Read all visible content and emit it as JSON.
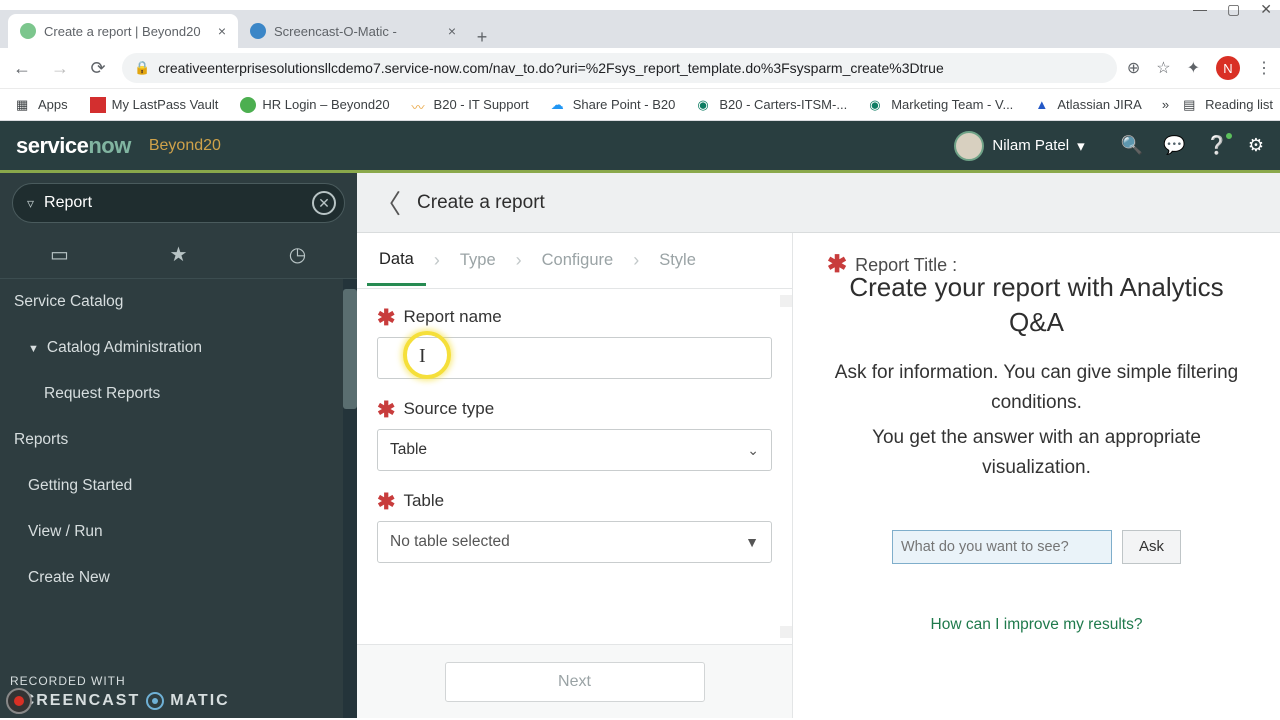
{
  "browser": {
    "tabs": [
      {
        "title": "Create a report | Beyond20",
        "favicon_color": "#7cc68d",
        "active": true
      },
      {
        "title": "Screencast-O-Matic -",
        "favicon_color": "#3b86c7",
        "active": false
      }
    ],
    "url": "creativeenterprisesolutionsllcdemo7.service-now.com/nav_to.do?uri=%2Fsys_report_template.do%3Fsysparm_create%3Dtrue",
    "avatar_letter": "N",
    "bookmarks": [
      {
        "label": "Apps",
        "icon": "grid"
      },
      {
        "label": "My LastPass Vault",
        "icon": "red"
      },
      {
        "label": "HR Login – Beyond20",
        "icon": "green"
      },
      {
        "label": "B20 - IT Support",
        "icon": "orange"
      },
      {
        "label": "Share Point - B20",
        "icon": "cloud"
      },
      {
        "label": "B20 - Carters-ITSM-...",
        "icon": "share"
      },
      {
        "label": "Marketing Team - V...",
        "icon": "share"
      },
      {
        "label": "Atlassian JIRA",
        "icon": "jira"
      }
    ],
    "reading_list": "Reading list"
  },
  "header": {
    "logo_a": "service",
    "logo_b": "now",
    "instance": "Beyond20",
    "user": "Nilam Patel"
  },
  "nav": {
    "filter_value": "Report",
    "items": [
      {
        "label": "Service Catalog",
        "cls": "section"
      },
      {
        "label": "Catalog Administration",
        "cls": "sub",
        "caret": true
      },
      {
        "label": "Request Reports",
        "cls": "subsub"
      },
      {
        "label": "Reports",
        "cls": "section"
      },
      {
        "label": "Getting Started",
        "cls": "sub"
      },
      {
        "label": "View / Run",
        "cls": "sub"
      },
      {
        "label": "Create New",
        "cls": "sub"
      }
    ]
  },
  "page": {
    "title": "Create a report",
    "wizard": [
      "Data",
      "Type",
      "Configure",
      "Style"
    ],
    "active_step": 0,
    "fields": {
      "report_name_label": "Report name",
      "report_name_value": "",
      "source_type_label": "Source type",
      "source_type_value": "Table",
      "table_label": "Table",
      "table_value": "No table selected"
    },
    "next": "Next"
  },
  "qa": {
    "label": "Report Title :",
    "heading": "Create your report with Analytics Q&A",
    "p1": "Ask for information. You can give simple filtering conditions.",
    "p2": "You get the answer with an appropriate visualization.",
    "placeholder": "What do you want to see?",
    "ask": "Ask",
    "help": "How can I improve my results?"
  },
  "recorder": {
    "line1": "RECORDED WITH",
    "line2a": "SCREENCAST",
    "line2b": "MATIC"
  }
}
